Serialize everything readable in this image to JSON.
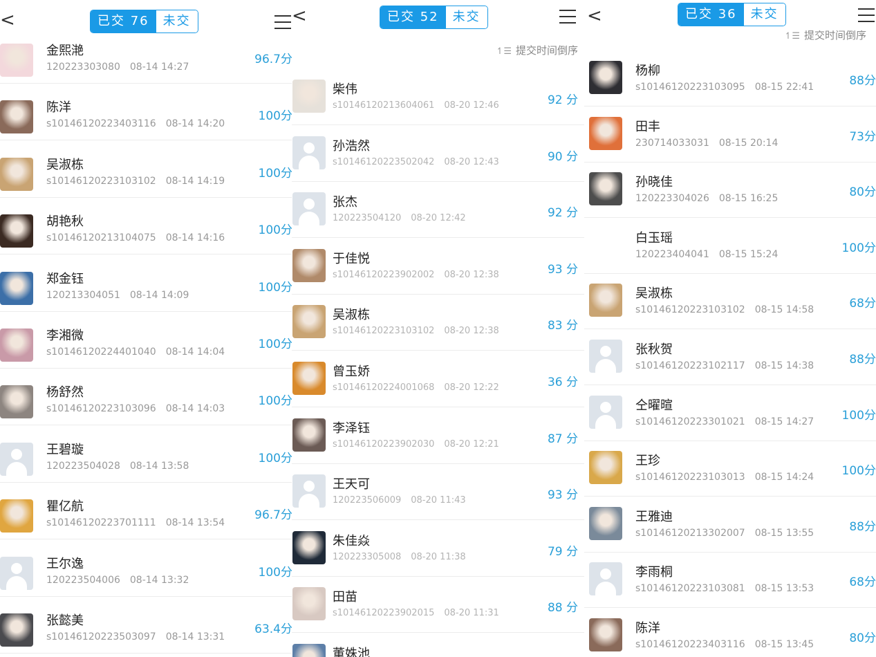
{
  "panels": [
    {
      "back": "<",
      "submitted_tab": "已交 76",
      "unsubmitted_tab": "未交",
      "sort_label": "",
      "students": [
        {
          "name": "金熙滟",
          "id": "120223303080",
          "time": "08-14 14:27",
          "score": "96.7分",
          "avatar": "photo",
          "color": "#f3d8dc"
        },
        {
          "name": "陈洋",
          "id": "s10146120223403116",
          "time": "08-14 14:20",
          "score": "100分",
          "avatar": "photo",
          "color": "#8a6a5a"
        },
        {
          "name": "吴淑栋",
          "id": "s10146120223103102",
          "time": "08-14 14:19",
          "score": "100分",
          "avatar": "photo",
          "color": "#c9a473"
        },
        {
          "name": "胡艳秋",
          "id": "s10146120213104075",
          "time": "08-14 14:16",
          "score": "100分",
          "avatar": "photo",
          "color": "#3b2a22"
        },
        {
          "name": "郑金钰",
          "id": "120213304051",
          "time": "08-14 14:09",
          "score": "100分",
          "avatar": "photo",
          "color": "#3c6fa8"
        },
        {
          "name": "李湘微",
          "id": "s10146120224401040",
          "time": "08-14 14:04",
          "score": "100分",
          "avatar": "photo",
          "color": "#c99aa8"
        },
        {
          "name": "杨舒然",
          "id": "s10146120223103096",
          "time": "08-14 14:03",
          "score": "100分",
          "avatar": "photo",
          "color": "#8d8580"
        },
        {
          "name": "王碧璇",
          "id": "120223504028",
          "time": "08-14 13:58",
          "score": "100分",
          "avatar": "default",
          "color": "#dde3ea"
        },
        {
          "name": "瞿亿航",
          "id": "s10146120223701111",
          "time": "08-14 13:54",
          "score": "96.7分",
          "avatar": "photo",
          "color": "#e0a640"
        },
        {
          "name": "王尔逸",
          "id": "120223504006",
          "time": "08-14 13:32",
          "score": "100分",
          "avatar": "default",
          "color": "#dde3ea"
        },
        {
          "name": "张懿美",
          "id": "s10146120223503097",
          "time": "08-14 13:31",
          "score": "63.4分",
          "avatar": "photo",
          "color": "#4a4a4e"
        }
      ]
    },
    {
      "back": "<",
      "submitted_tab": "已交 52",
      "unsubmitted_tab": "未交",
      "sort_label": "提交时间倒序",
      "students": [
        {
          "name": "柴伟",
          "id": "s10146120213604061",
          "time": "08-20 12:46",
          "score": "92 分",
          "avatar": "photo",
          "color": "#e6e1da"
        },
        {
          "name": "孙浩然",
          "id": "s10146120223502042",
          "time": "08-20 12:43",
          "score": "90 分",
          "avatar": "default",
          "color": "#dde3ea"
        },
        {
          "name": "张杰",
          "id": "120223504120",
          "time": "08-20 12:42",
          "score": "92 分",
          "avatar": "default",
          "color": "#dde3ea"
        },
        {
          "name": "于佳悦",
          "id": "s10146120223902002",
          "time": "08-20 12:38",
          "score": "93 分",
          "avatar": "photo",
          "color": "#b08a6a"
        },
        {
          "name": "吴淑栋",
          "id": "s10146120223103102",
          "time": "08-20 12:38",
          "score": "83 分",
          "avatar": "photo",
          "color": "#c9a473"
        },
        {
          "name": "曾玉娇",
          "id": "s10146120224001068",
          "time": "08-20 12:22",
          "score": "36 分",
          "avatar": "photo",
          "color": "#d98a2c"
        },
        {
          "name": "李泽钰",
          "id": "s10146120223902030",
          "time": "08-20 12:21",
          "score": "87 分",
          "avatar": "photo",
          "color": "#6b5b55"
        },
        {
          "name": "王天可",
          "id": "120223506009",
          "time": "08-20 11:43",
          "score": "93 分",
          "avatar": "default",
          "color": "#dde3ea"
        },
        {
          "name": "朱佳焱",
          "id": "120223305008",
          "time": "08-20 11:38",
          "score": "79 分",
          "avatar": "photo",
          "color": "#1f2a38"
        },
        {
          "name": "田苗",
          "id": "s10146120223902015",
          "time": "08-20 11:31",
          "score": "88 分",
          "avatar": "photo",
          "color": "#d8c9c2"
        },
        {
          "name": "董姝池",
          "id": "",
          "time": "",
          "score": "",
          "avatar": "photo",
          "color": "#5d7fa8"
        }
      ]
    },
    {
      "back": "<",
      "submitted_tab": "已交 36",
      "unsubmitted_tab": "未交",
      "sort_label": "提交时间倒序",
      "students": [
        {
          "name": "杨柳",
          "id": "s10146120223103095",
          "time": "08-15 22:41",
          "score": "88分",
          "avatar": "photo",
          "color": "#2e2e33"
        },
        {
          "name": "田丰",
          "id": "230714033031",
          "time": "08-15 20:14",
          "score": "73分",
          "avatar": "photo",
          "color": "#e0703a"
        },
        {
          "name": "孙晓佳",
          "id": "120223304026",
          "time": "08-15 16:25",
          "score": "80分",
          "avatar": "photo",
          "color": "#4d4d4d"
        },
        {
          "name": "白玉瑶",
          "id": "120223404041",
          "time": "08-15 15:24",
          "score": "100分",
          "avatar": "none",
          "color": "#ffffff"
        },
        {
          "name": "吴淑栋",
          "id": "s10146120223103102",
          "time": "08-15 14:58",
          "score": "68分",
          "avatar": "photo",
          "color": "#c9a473"
        },
        {
          "name": "张秋贺",
          "id": "s10146120223102117",
          "time": "08-15 14:38",
          "score": "88分",
          "avatar": "default",
          "color": "#dde3ea"
        },
        {
          "name": "仝曜暄",
          "id": "s10146120223301021",
          "time": "08-15 14:27",
          "score": "100分",
          "avatar": "default",
          "color": "#dde3ea"
        },
        {
          "name": "王珍",
          "id": "s10146120223103013",
          "time": "08-15 14:24",
          "score": "100分",
          "avatar": "photo",
          "color": "#d9a84a"
        },
        {
          "name": "王雅迪",
          "id": "s10146120213302007",
          "time": "08-15 13:55",
          "score": "88分",
          "avatar": "photo",
          "color": "#7a8a9a"
        },
        {
          "name": "李雨桐",
          "id": "s10146120223103081",
          "time": "08-15 13:53",
          "score": "68分",
          "avatar": "default",
          "color": "#dde3ea"
        },
        {
          "name": "陈洋",
          "id": "s10146120223403116",
          "time": "08-15 13:45",
          "score": "80分",
          "avatar": "photo",
          "color": "#8a6a5a"
        }
      ]
    }
  ]
}
